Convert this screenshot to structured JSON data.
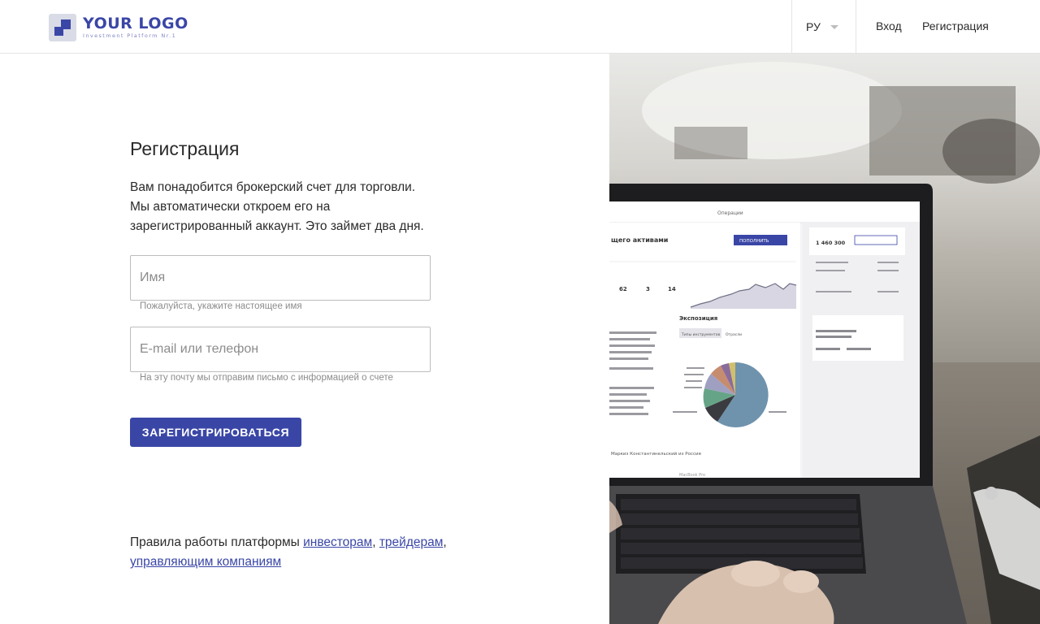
{
  "header": {
    "logo": {
      "title": "YOUR LOGO",
      "subtitle": "Investment Platform Nr.1"
    },
    "language": "РУ",
    "nav": {
      "login": "Вход",
      "register": "Регистрация"
    }
  },
  "form": {
    "title": "Регистрация",
    "intro_lines": [
      "Вам понадобится брокерский счет для торговли.",
      "Мы автоматически откроем его на",
      "зарегистрированный аккаунт. Это займет два дня."
    ],
    "name_field": {
      "placeholder": "Имя",
      "value": "",
      "hint": "Пожалуйста, укажите настоящее имя"
    },
    "email_field": {
      "placeholder": "E-mail или телефон",
      "value": "",
      "hint": "На эту почту мы отправим письмо с информацией о счете"
    },
    "submit_label": "ЗАРЕГИСТРИРОВАТЬСЯ"
  },
  "rules": {
    "prefix": "Правила работы платформы",
    "links": [
      "инвесторам",
      "трейдерам",
      "управляющим компаниям"
    ],
    "separator": ","
  },
  "photo": {
    "screen_header": "Операции",
    "screen_title": "щего активами",
    "screen_button": "ПОПОЛНИТЬ",
    "exposition_label": "Экспозиция",
    "balance": "1 460 300",
    "brand": "MacBook Pro",
    "labels": [
      "Отрасли",
      "Типы инструментов"
    ]
  },
  "colors": {
    "accent": "#3a46a6",
    "text": "#2b2b2b",
    "muted": "#8c8c8c",
    "border": "#bdbdbd"
  }
}
